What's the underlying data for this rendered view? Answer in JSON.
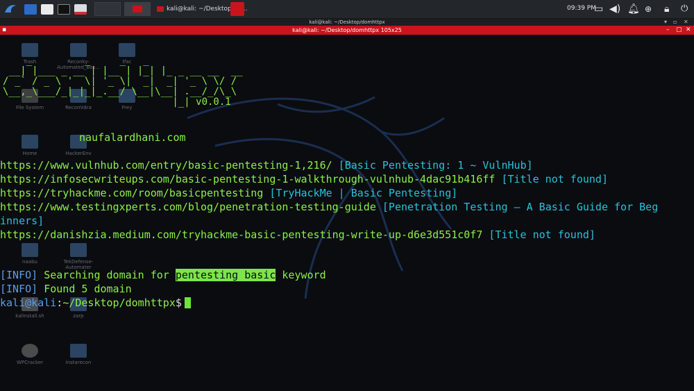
{
  "panel": {
    "clock": "09:39 PM",
    "task": {
      "label": "kali@kali: ~/Desktop/do..."
    }
  },
  "window": {
    "title": "kali@kali: ~/Desktop/domhttpx 105x25",
    "header_title": "kali@kali: ~/Desktop/domhttpx"
  },
  "desktop": {
    "icons": [
      "Trash",
      "Reconky-Automated_Bas...",
      "tfac",
      "File System",
      "ReconVdra",
      "Frey",
      "Home",
      "HackerEnv",
      "naabu",
      "TekDefense-Automater",
      "kalinstall.sh",
      "zarp",
      "WPCracker",
      "instarecon"
    ]
  },
  "terminal": {
    "banner_art": "    _         _     _   _\n __| |___ _ __ | |__ | |_| |_ _ __ __  __\n/ _` / _ \\ '  \\| '_ \\|  _|  _| '_ \\ \\/ /\n\\__,_\\___/_|_|_|_.__/ \\__|\\__| .__/_/\\_\\\n                             |_| v0.0.1",
    "version": "v0.0.1",
    "author": "naufalardhani.com",
    "results": [
      {
        "url": "https://www.vulnhub.com/entry/basic-pentesting-1,216/",
        "title": "[Basic Pentesting: 1 ~ VulnHub]"
      },
      {
        "url": "https://infosecwriteups.com/basic-pentesting-1-walkthrough-vulnhub-4dac91b416ff",
        "title": "[Title not found]"
      },
      {
        "url": "https://tryhackme.com/room/basicpentesting",
        "title": "[TryHackMe | Basic Pentesting]"
      },
      {
        "url": "https://www.testingxperts.com/blog/penetration-testing-guide",
        "title": "[Penetration Testing – A Basic Guide for Beg"
      },
      {
        "url": "inners]",
        "title": ""
      },
      {
        "url": "https://danishzia.medium.com/tryhackme-basic-pentesting-write-up-d6e3d551c0f7",
        "title": "[Title not found]"
      }
    ],
    "info1": {
      "tag": "[INFO]",
      "pre": " Searching domain for ",
      "keyword": "pentesting basic",
      "post": " keyword"
    },
    "info2": {
      "tag": "[INFO]",
      "text": " Found 5 domain"
    },
    "prompt": {
      "user": "kali@kali",
      "sep": ":",
      "path": "~/Desktop/domhttpx",
      "sym": "$"
    }
  },
  "colors": {
    "green": "#8df046",
    "cyan": "#27c3d6",
    "blue": "#5c9ee8",
    "titlebar": "#c8141a"
  }
}
